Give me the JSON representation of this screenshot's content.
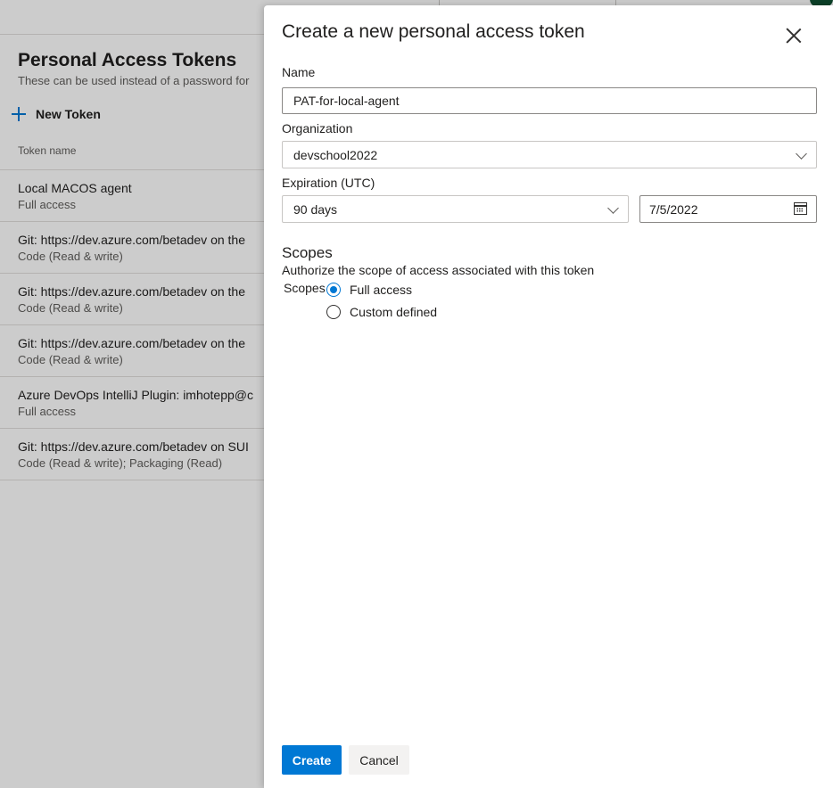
{
  "background": {
    "title": "Personal Access Tokens",
    "subtitle": "These can be used instead of a password for",
    "new_token_label": "New Token",
    "column_header": "Token name",
    "tokens": [
      {
        "name": "Local MACOS agent",
        "scope": "Full access"
      },
      {
        "name": "Git: https://dev.azure.com/betadev on the",
        "scope": "Code (Read & write)"
      },
      {
        "name": "Git: https://dev.azure.com/betadev on the",
        "scope": "Code (Read & write)"
      },
      {
        "name": "Git: https://dev.azure.com/betadev on the",
        "scope": "Code (Read & write)"
      },
      {
        "name": "Azure DevOps IntelliJ Plugin: imhotepp@c",
        "scope": "Full access"
      },
      {
        "name": "Git: https://dev.azure.com/betadev on SUI",
        "scope": "Code (Read & write); Packaging (Read)"
      }
    ]
  },
  "panel": {
    "title": "Create a new personal access token",
    "name_label": "Name",
    "name_value": "PAT-for-local-agent",
    "organization_label": "Organization",
    "organization_value": "devschool2022",
    "expiration_label": "Expiration (UTC)",
    "expiration_value": "90 days",
    "expiration_date": "7/5/2022",
    "scopes_heading": "Scopes",
    "scopes_description": "Authorize the scope of access associated with this token",
    "scopes_label": "Scopes",
    "scope_options": [
      {
        "label": "Full access",
        "checked": true
      },
      {
        "label": "Custom defined",
        "checked": false
      }
    ],
    "create_label": "Create",
    "cancel_label": "Cancel"
  },
  "colors": {
    "accent": "#0078d4",
    "overlay": "rgba(0,0,0,0.2)"
  }
}
